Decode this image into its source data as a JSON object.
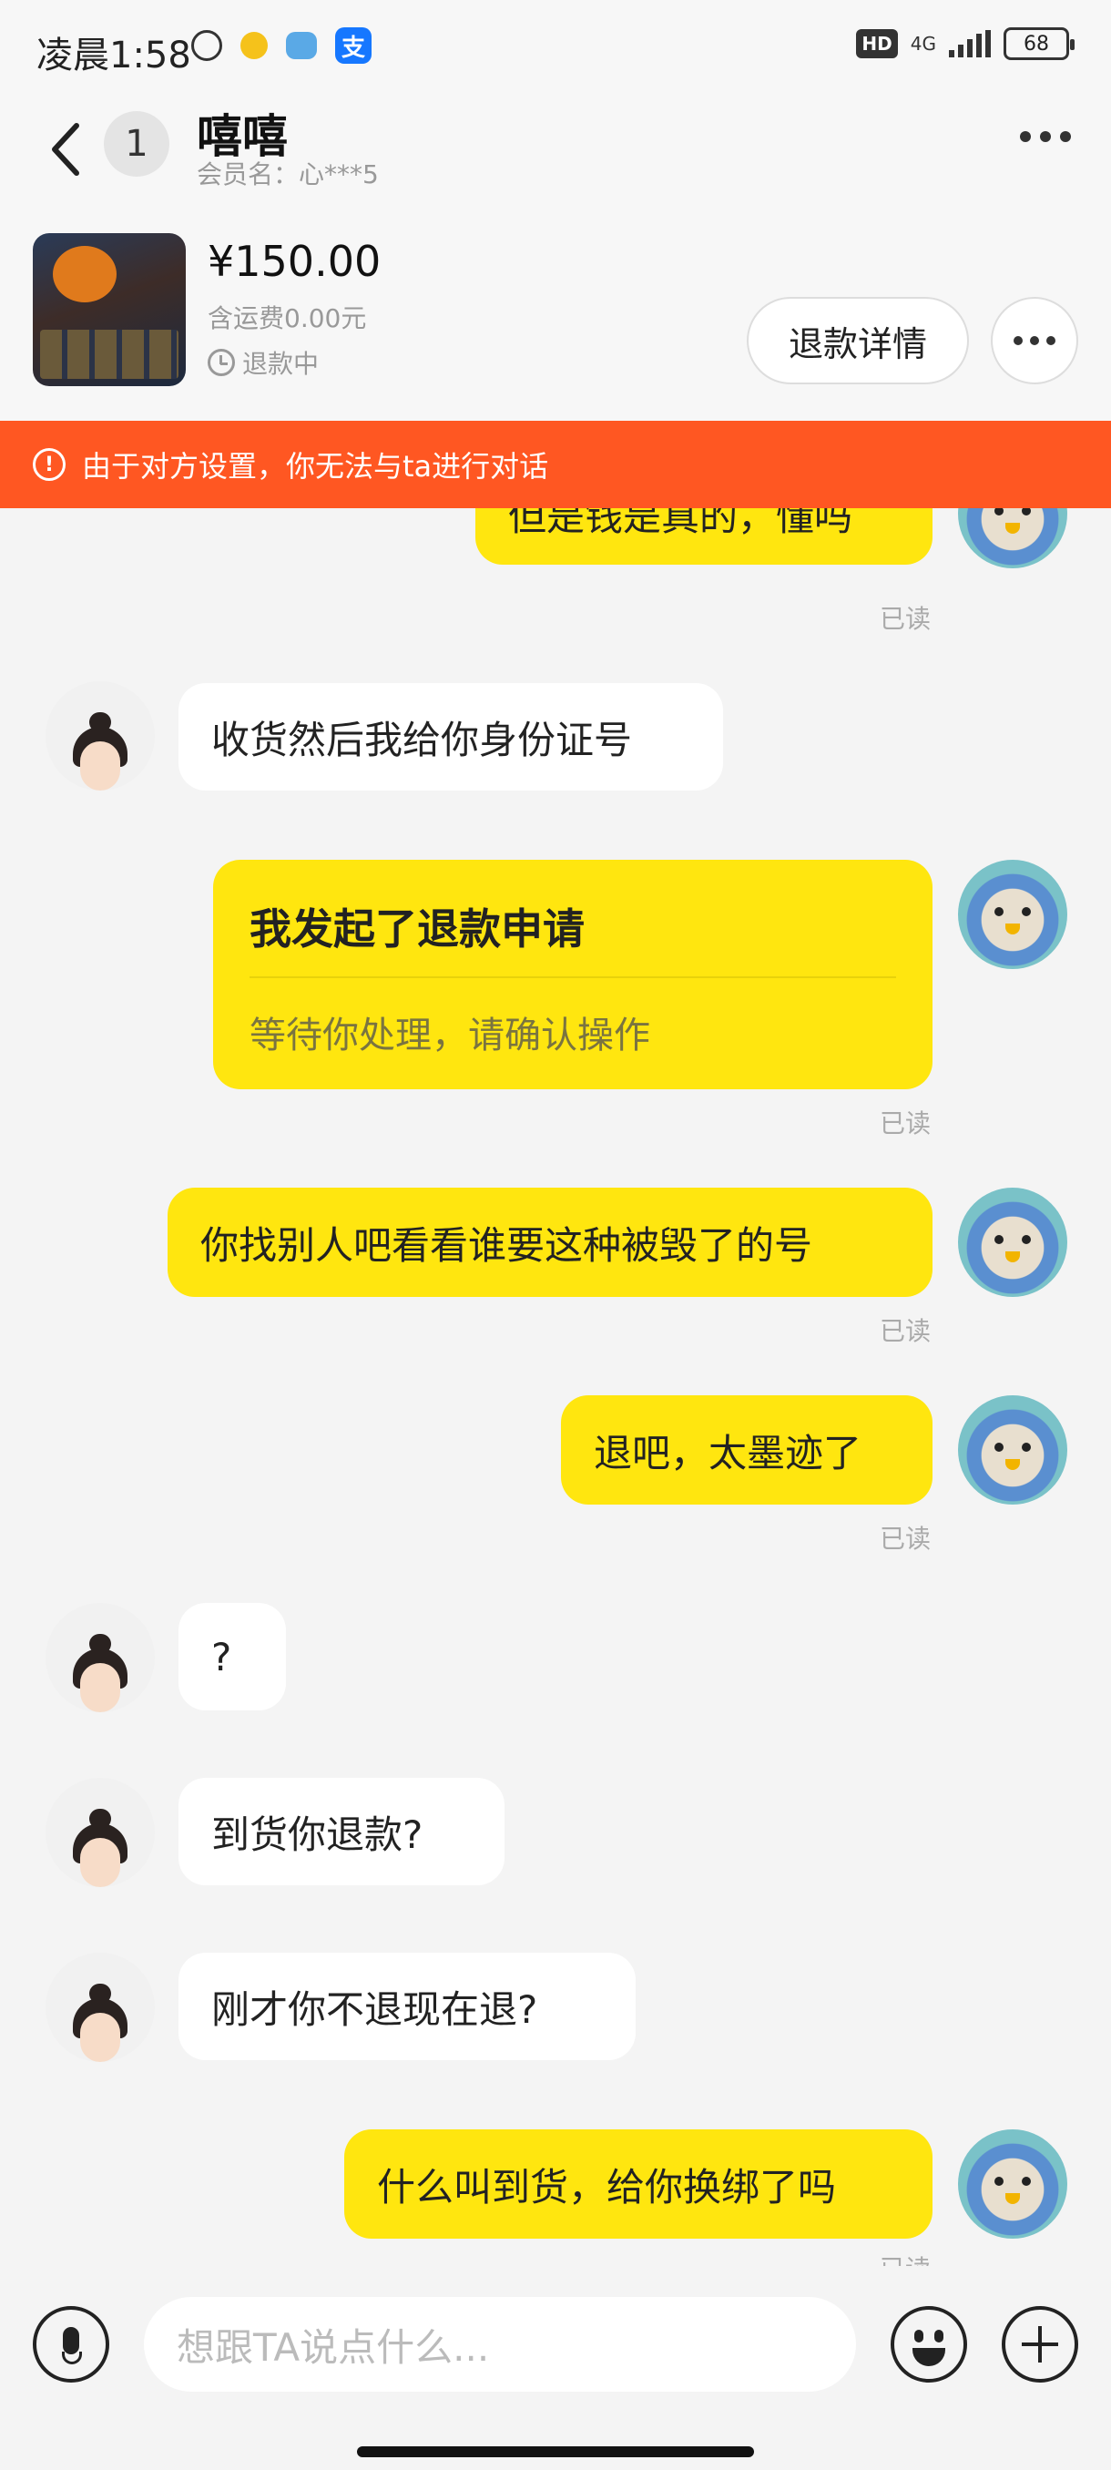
{
  "status_bar": {
    "time": "凌晨1:58",
    "hd": "HD",
    "network": "4G",
    "battery": "68"
  },
  "header": {
    "unread_count": "1",
    "name": "嘻嘻",
    "member": "会员名：心***5"
  },
  "product": {
    "price": "¥150.00",
    "shipping": "含运费0.00元",
    "status": "退款中",
    "refund_button": "退款详情"
  },
  "banner": {
    "text": "由于对方设置，你无法与ta进行对话"
  },
  "messages": [
    {
      "side": "right",
      "text": "但是钱是真的，懂吗",
      "read": "已读"
    },
    {
      "side": "left",
      "text": "收货然后我给你身份证号"
    },
    {
      "side": "right",
      "type": "card",
      "title": "我发起了退款申请",
      "subtitle": "等待你处理，请确认操作",
      "read": "已读"
    },
    {
      "side": "right",
      "text": "你找别人吧看看谁要这种被毁了的号",
      "read": "已读"
    },
    {
      "side": "right",
      "text": "退吧，太墨迹了",
      "read": "已读"
    },
    {
      "side": "left",
      "text": "?"
    },
    {
      "side": "left",
      "text": "到货你退款?"
    },
    {
      "side": "left",
      "text": "刚才你不退现在退?"
    },
    {
      "side": "right",
      "text": "什么叫到货，给你换绑了吗",
      "read": "已读"
    }
  ],
  "input": {
    "placeholder": "想跟TA说点什么..."
  },
  "colors": {
    "bubble_self": "#ffe60f",
    "banner": "#ff5722",
    "background": "#f4f4f4"
  }
}
